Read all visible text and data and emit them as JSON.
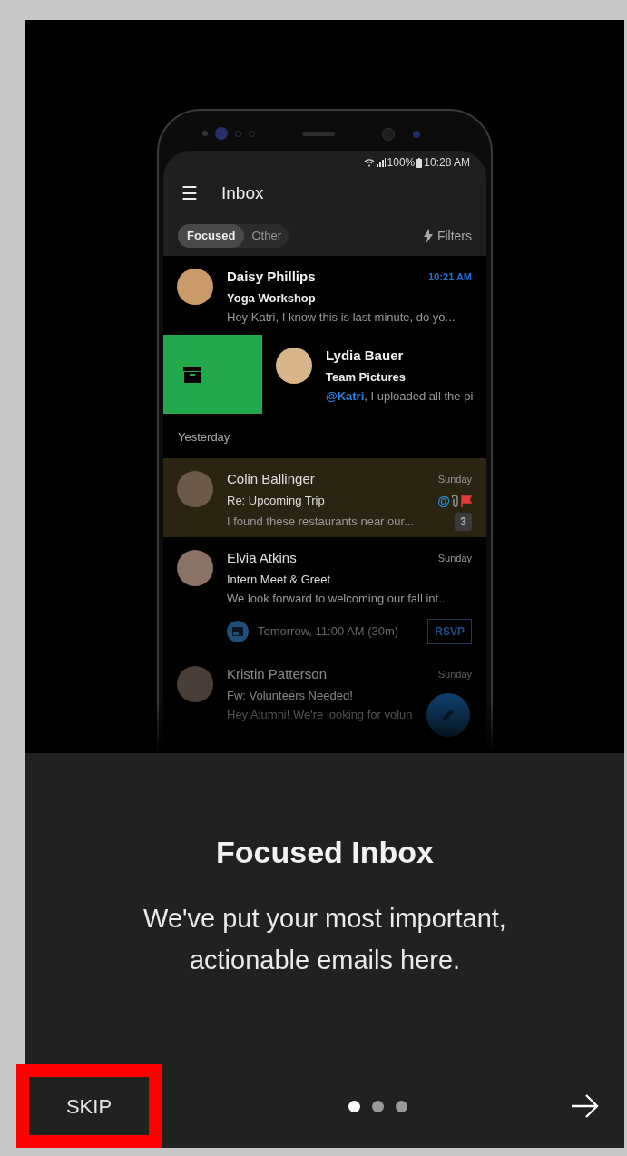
{
  "phone": {
    "status_bar": {
      "battery": "100%",
      "time": "10:28 AM"
    },
    "app_bar": {
      "menu_icon": "☰",
      "title": "Inbox"
    },
    "tabs": [
      {
        "label": "Focused",
        "selected": true
      },
      {
        "label": "Other",
        "selected": false
      }
    ],
    "filters": "Filters",
    "messages": [
      {
        "kind": "mail",
        "sender": "Daisy Phillips",
        "subject": "Yoga Workshop",
        "preview": "Hey Katri, I know this is last minute, do yo...",
        "time": "10:21 AM",
        "unread": true,
        "highlighted": false,
        "faded": false,
        "swiped": false
      },
      {
        "kind": "mail",
        "sender": "Lydia Bauer",
        "subject": "Team Pictures",
        "preview": "**@Katri**, I uploaded all the pi",
        "unread": true,
        "highlighted": false,
        "faded": false,
        "swiped": true
      },
      {
        "kind": "section",
        "label": "Yesterday"
      },
      {
        "kind": "mail",
        "sender": "Colin Ballinger",
        "subject": "Re: Upcoming Trip",
        "preview": "I found these restaurants near our...",
        "time": "Sunday",
        "unread": false,
        "highlighted": true,
        "faded": false,
        "swiped": false,
        "mention": "@",
        "attachment": true,
        "flagged": true,
        "count": "3"
      },
      {
        "kind": "mail",
        "sender": "Elvia Atkins",
        "subject": "Intern Meet & Greet",
        "preview": "We look forward to welcoming our fall int..",
        "time": "Sunday",
        "unread": false,
        "highlighted": false,
        "faded": false,
        "swiped": false,
        "event": "Tomorrow, 11:00 AM (30m)",
        "rsvp": "RSVP"
      },
      {
        "kind": "mail",
        "sender": "Kristin Patterson",
        "subject": "Fw: Volunteers Needed!",
        "preview": "Hey Alumni! We're looking for volun",
        "time": "Sunday",
        "unread": false,
        "highlighted": false,
        "faded": true,
        "swiped": false
      }
    ]
  },
  "title": "Focused Inbox",
  "body": "We've put your most important, actionable emails here.",
  "pager": [
    {
      "selected": true
    },
    {
      "selected": false
    },
    {
      "selected": false
    }
  ],
  "skip": {
    "label": "SKIP",
    "highlighted": true
  }
}
